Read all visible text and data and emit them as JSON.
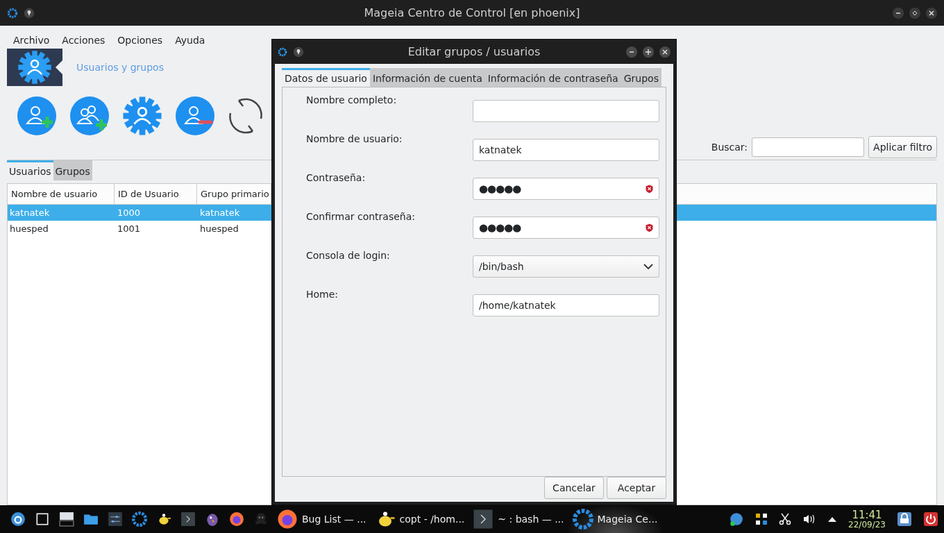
{
  "main_window": {
    "title": "Mageia Centro de Control [en phoenix]",
    "menu": [
      {
        "label": "Archivo"
      },
      {
        "label": "Acciones"
      },
      {
        "label": "Opciones"
      },
      {
        "label": "Ayuda"
      }
    ],
    "header": {
      "title": "Usuarios y grupos"
    },
    "toolbar": [
      {
        "kind": "add-user"
      },
      {
        "kind": "add-group"
      },
      {
        "kind": "edit"
      },
      {
        "kind": "delete"
      },
      {
        "kind": "refresh"
      }
    ],
    "search": {
      "label": "Buscar:",
      "button": "Aplicar filtro"
    },
    "tabs": [
      {
        "label": "Usuarios",
        "selected": true
      },
      {
        "label": "Grupos",
        "selected": false
      }
    ],
    "table": {
      "columns": [
        "Nombre de usuario",
        "ID de Usuario",
        "Grupo primario"
      ],
      "rows": [
        {
          "cells": [
            "katnatek",
            "1000",
            "katnatek"
          ],
          "selected": true
        },
        {
          "cells": [
            "huesped",
            "1001",
            "huesped"
          ],
          "selected": false
        }
      ]
    }
  },
  "dialog": {
    "title": "Editar grupos / usuarios",
    "tabs": [
      {
        "label": "Datos de usuario",
        "selected": true
      },
      {
        "label": "Información de cuenta",
        "selected": false
      },
      {
        "label": "Información de contraseña",
        "selected": false
      },
      {
        "label": "Grupos",
        "selected": false
      }
    ],
    "fields": [
      {
        "kind": "text",
        "label": "Nombre completo:"
      },
      {
        "kind": "text",
        "label": "Nombre de usuario:",
        "value": "katnatek"
      },
      {
        "kind": "password",
        "label": "Contraseña:",
        "value": "●●●●●"
      },
      {
        "kind": "password",
        "label": "Confirmar contraseña:",
        "value": "●●●●●"
      },
      {
        "kind": "select",
        "label": "Consola de login:",
        "value": "/bin/bash"
      },
      {
        "kind": "text",
        "label": "Home:",
        "value": "/home/katnatek"
      }
    ],
    "buttons": [
      "Cancelar",
      "Aceptar"
    ]
  },
  "taskbar": {
    "tasks": [
      {
        "label": "Bug List — ...",
        "selected": false
      },
      {
        "label": "copt - /hom...",
        "selected": false
      },
      {
        "label": "~ : bash — ...",
        "selected": false
      },
      {
        "label": "Mageia Ce...",
        "selected": true
      }
    ],
    "clock": {
      "time": "11:41",
      "date": "22/09/23"
    }
  }
}
